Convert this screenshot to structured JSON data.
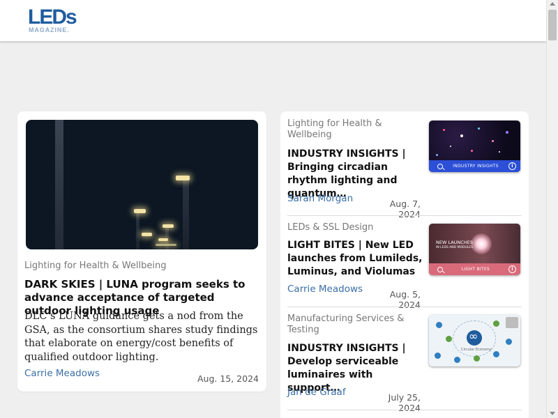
{
  "header": {
    "logo_main": "LEDs",
    "logo_sub": "MAGAZINE."
  },
  "featured": {
    "category": "Lighting for Health & Wellbeing",
    "title": "DARK SKIES | LUNA program seeks to advance acceptance of targeted outdoor lighting usage",
    "description": "DLC’s LUNA guidance gets a nod from the GSA, as the consortium shares study findings that elaborate on energy/cost benefits of qualified outdoor lighting.",
    "author": "Carrie Meadows",
    "date": "Aug. 15, 2024"
  },
  "list": [
    {
      "category": "Lighting for Health & Wellbeing",
      "title": "INDUSTRY INSIGHTS | Bringing circadian rhythm lighting and quantum…",
      "author": "Sarah Morgan",
      "date": "Aug. 7, 2024",
      "thumb_label": "INDUSTRY INSIGHTS",
      "thumb_bar_color": "#2b4fd6"
    },
    {
      "category": "LEDs & SSL Design",
      "title": "LIGHT BITES | New LED launches from Lumileds, Luminus, and Violumas",
      "author": "Carrie Meadows",
      "date": "Aug. 5, 2024",
      "thumb_label": "LIGHT BITES",
      "thumb_text": "NEW LAUNCHES",
      "thumb_subtext": "IN LEDS AND MODULES",
      "thumb_bar_color": "#d96a7a"
    },
    {
      "category": "Manufacturing Services & Testing",
      "title": "INDUSTRY INSIGHTS | Develop serviceable luminaires with support…",
      "author": "Jan de Graaf",
      "date": "July 25, 2024",
      "thumb_caption": "Circular Economy"
    }
  ],
  "icons": {
    "search": "search-icon",
    "info": "info-icon"
  },
  "colors": {
    "brand": "#1f5c9e",
    "author_link": "#3a6ea5"
  }
}
